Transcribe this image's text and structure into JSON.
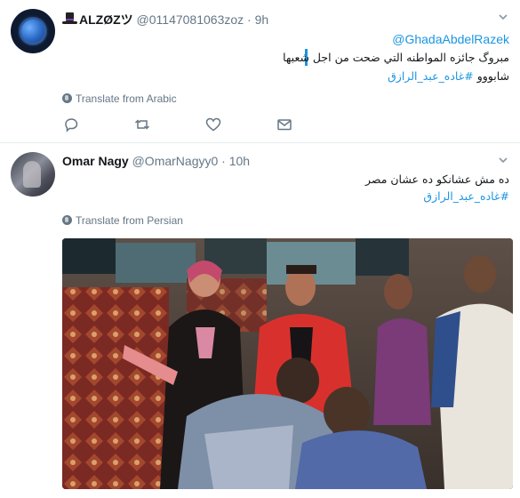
{
  "tweets": [
    {
      "name": "ALZØZツ",
      "handle": "@01147081063zoz",
      "dot": "·",
      "time": "9h",
      "mention": "@GhadaAbdelRazek",
      "line1": "مبروگ جائزه المواطنه التي ضحت من اجل شعبها",
      "hashtag": "#غاده_عبد_الرازق",
      "line2_suffix": "شابووو",
      "translate": "Translate from Arabic",
      "actions": [
        "reply-icon",
        "retweet-icon",
        "like-icon",
        "dm-icon"
      ]
    },
    {
      "name": "Omar Nagy",
      "handle": "@OmarNagyy0",
      "dot": "·",
      "time": "10h",
      "line1": "ده مش عشانكو ده عشان مصر",
      "hashtag": "#غاده_عبد_الرازق",
      "translate": "Translate from Persian",
      "media": "gif-still-scene"
    }
  ],
  "colors": {
    "link": "#1b95e0",
    "muted": "#657786",
    "text": "#14171a",
    "divider": "#e6ecf0"
  }
}
